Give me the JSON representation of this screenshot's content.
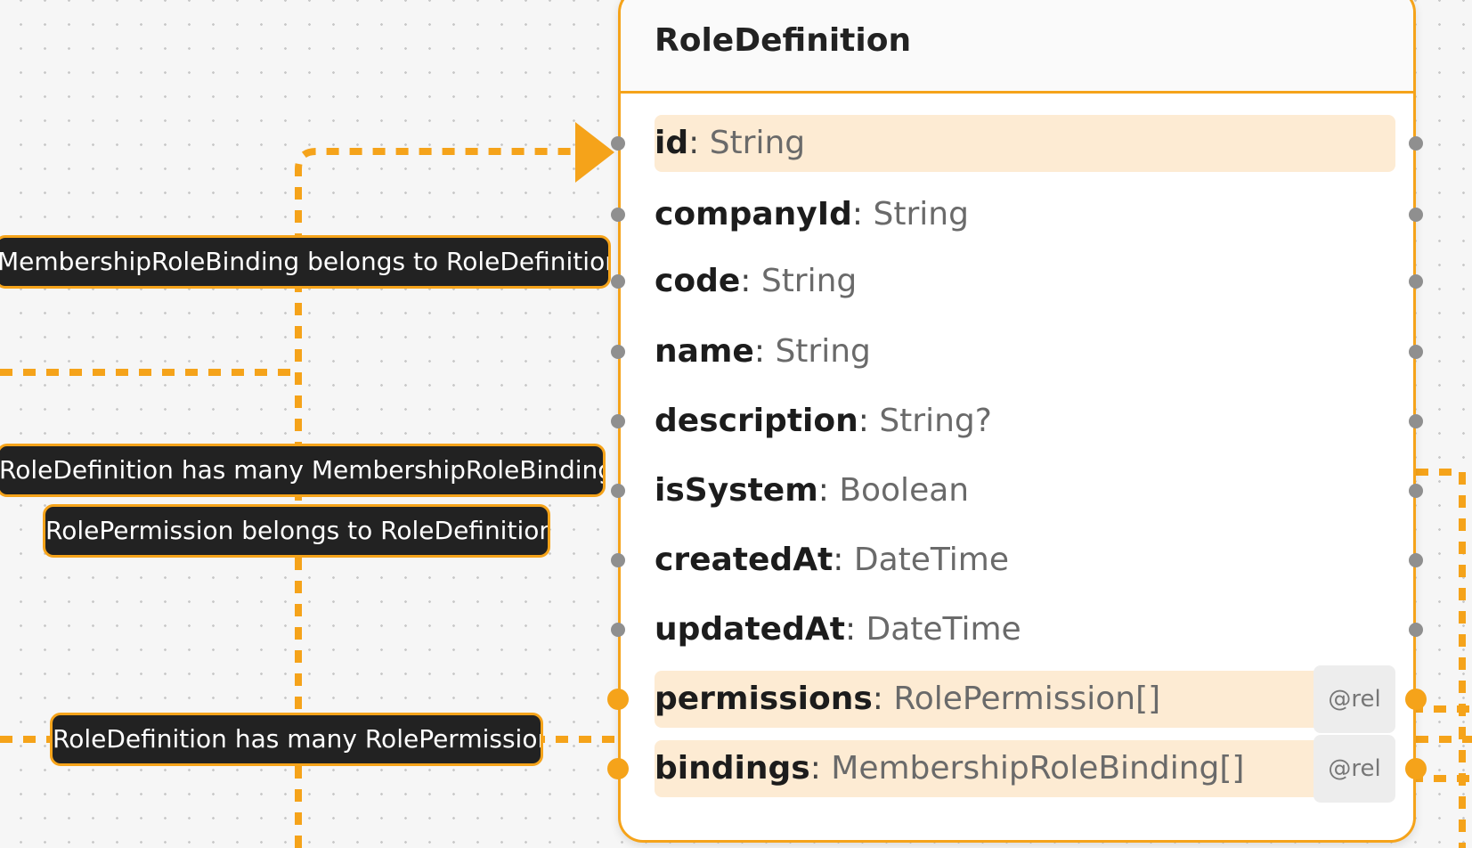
{
  "node": {
    "title": "RoleDefinition",
    "fields": [
      {
        "name": "id",
        "type": "String",
        "highlighted": true,
        "badge": ""
      },
      {
        "name": "companyId",
        "type": "String",
        "highlighted": false,
        "badge": ""
      },
      {
        "name": "code",
        "type": "String",
        "highlighted": false,
        "badge": ""
      },
      {
        "name": "name",
        "type": "String",
        "highlighted": false,
        "badge": ""
      },
      {
        "name": "description",
        "type": "String?",
        "highlighted": false,
        "badge": ""
      },
      {
        "name": "isSystem",
        "type": "Boolean",
        "highlighted": false,
        "badge": ""
      },
      {
        "name": "createdAt",
        "type": "DateTime",
        "highlighted": false,
        "badge": ""
      },
      {
        "name": "updatedAt",
        "type": "DateTime",
        "highlighted": false,
        "badge": ""
      },
      {
        "name": "permissions",
        "type": "RolePermission[]",
        "highlighted": true,
        "badge": "@rel"
      },
      {
        "name": "bindings",
        "type": "MembershipRoleBinding[]",
        "highlighted": true,
        "badge": "@rel"
      }
    ]
  },
  "edge_labels": [
    "MembershipRoleBinding belongs to RoleDefinition",
    "RoleDefinition has many MembershipRoleBinding",
    "RolePermission belongs to RoleDefinition",
    "RoleDefinition has many RolePermission"
  ],
  "colors": {
    "accent": "#f5a31a",
    "label_bg": "#222222",
    "canvas": "#f6f6f6",
    "row_highlight": "#fdebd3"
  }
}
